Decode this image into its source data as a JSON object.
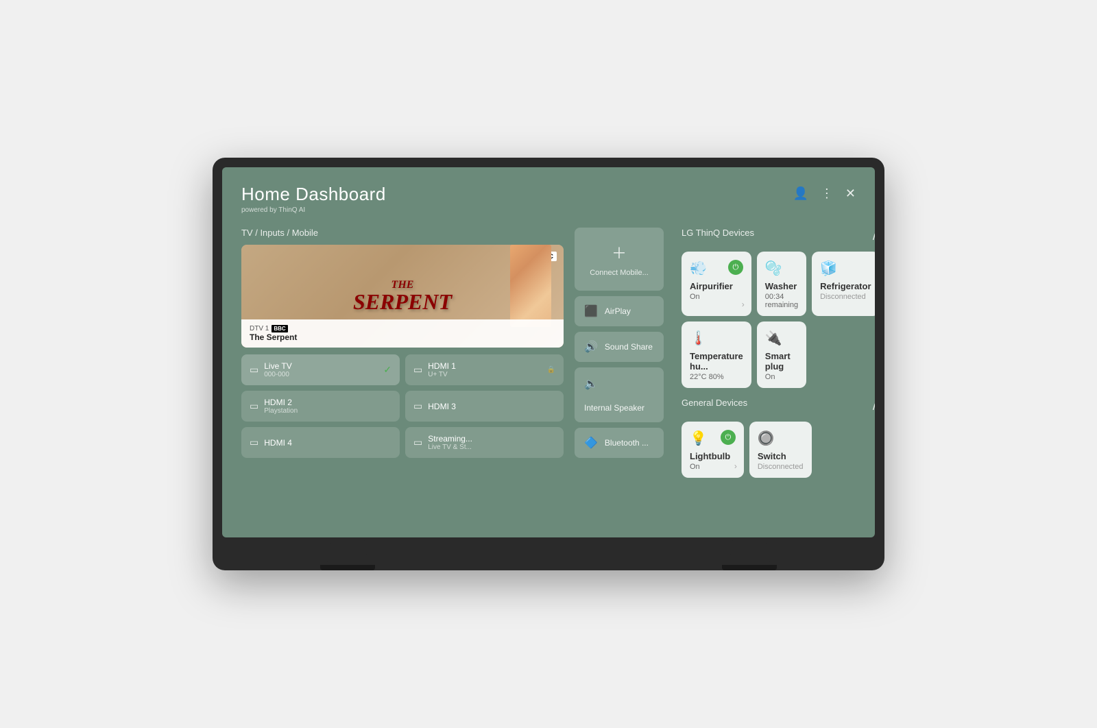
{
  "header": {
    "title": "Home Dashboard",
    "subtitle": "powered by ThinQ AI"
  },
  "tv_section": {
    "label": "TV / Inputs / Mobile",
    "channel": "DTV 1",
    "show": "The Serpent",
    "show_title_line1": "THE",
    "show_title_line2": "SERPENT"
  },
  "inputs": [
    {
      "id": "live-tv",
      "name": "Live TV",
      "sub": "000-000",
      "active": true,
      "icon": "📺"
    },
    {
      "id": "hdmi1",
      "name": "HDMI 1",
      "sub": "U+ TV",
      "active": false,
      "icon": "📻"
    },
    {
      "id": "hdmi2",
      "name": "HDMI 2",
      "sub": "Playstation",
      "active": false,
      "icon": "📻"
    },
    {
      "id": "hdmi3",
      "name": "HDMI 3",
      "sub": "",
      "active": false,
      "icon": "📻"
    },
    {
      "id": "hdmi4",
      "name": "HDMI 4",
      "sub": "",
      "active": false,
      "icon": "📻"
    },
    {
      "id": "streaming",
      "name": "Streaming...",
      "sub": "Live TV & St...",
      "active": false,
      "icon": "📻"
    }
  ],
  "mobile_connect": {
    "label": "Connect Mobile..."
  },
  "audio_options": [
    {
      "id": "airplay",
      "label": "AirPlay",
      "icon": "airplay"
    },
    {
      "id": "sound-share",
      "label": "Sound Share",
      "icon": "sound"
    },
    {
      "id": "internal-speaker",
      "label": "Internal Speaker",
      "icon": "speaker"
    },
    {
      "id": "bluetooth",
      "label": "Bluetooth ...",
      "icon": "bluetooth"
    }
  ],
  "thinq_section": {
    "label": "LG ThinQ Devices",
    "devices": [
      {
        "id": "airpurifier",
        "name": "Airpurifier",
        "status": "On",
        "powered": true,
        "icon": "💨",
        "disconnected": false
      },
      {
        "id": "washer",
        "name": "Washer",
        "status": "00:34 remaining",
        "powered": true,
        "icon": "🫧",
        "disconnected": false
      },
      {
        "id": "refrigerator",
        "name": "Refrigerator",
        "status": "Disconnected",
        "powered": false,
        "icon": "🧊",
        "disconnected": true
      },
      {
        "id": "temperature",
        "name": "Temperature hu...",
        "status": "22°C 80%",
        "powered": false,
        "icon": "🌡️",
        "disconnected": false
      },
      {
        "id": "smartplug",
        "name": "Smart plug",
        "status": "On",
        "powered": false,
        "icon": "🔌",
        "disconnected": false
      }
    ]
  },
  "general_section": {
    "label": "General Devices",
    "devices": [
      {
        "id": "lightbulb",
        "name": "Lightbulb",
        "status": "On",
        "powered": true,
        "icon": "💡",
        "disconnected": false
      },
      {
        "id": "switch",
        "name": "Switch",
        "status": "Disconnected",
        "powered": false,
        "icon": "🔘",
        "disconnected": true
      }
    ]
  },
  "icons": {
    "person": "👤",
    "more": "⋮",
    "close": "✕",
    "chevron_up": "∧",
    "check": "✓",
    "arrow_right": "›",
    "power": "⏻"
  },
  "colors": {
    "bg": "#6b8a7a",
    "tile_bg": "rgba(255,255,255,0.88)",
    "power_on": "#4caf50"
  }
}
